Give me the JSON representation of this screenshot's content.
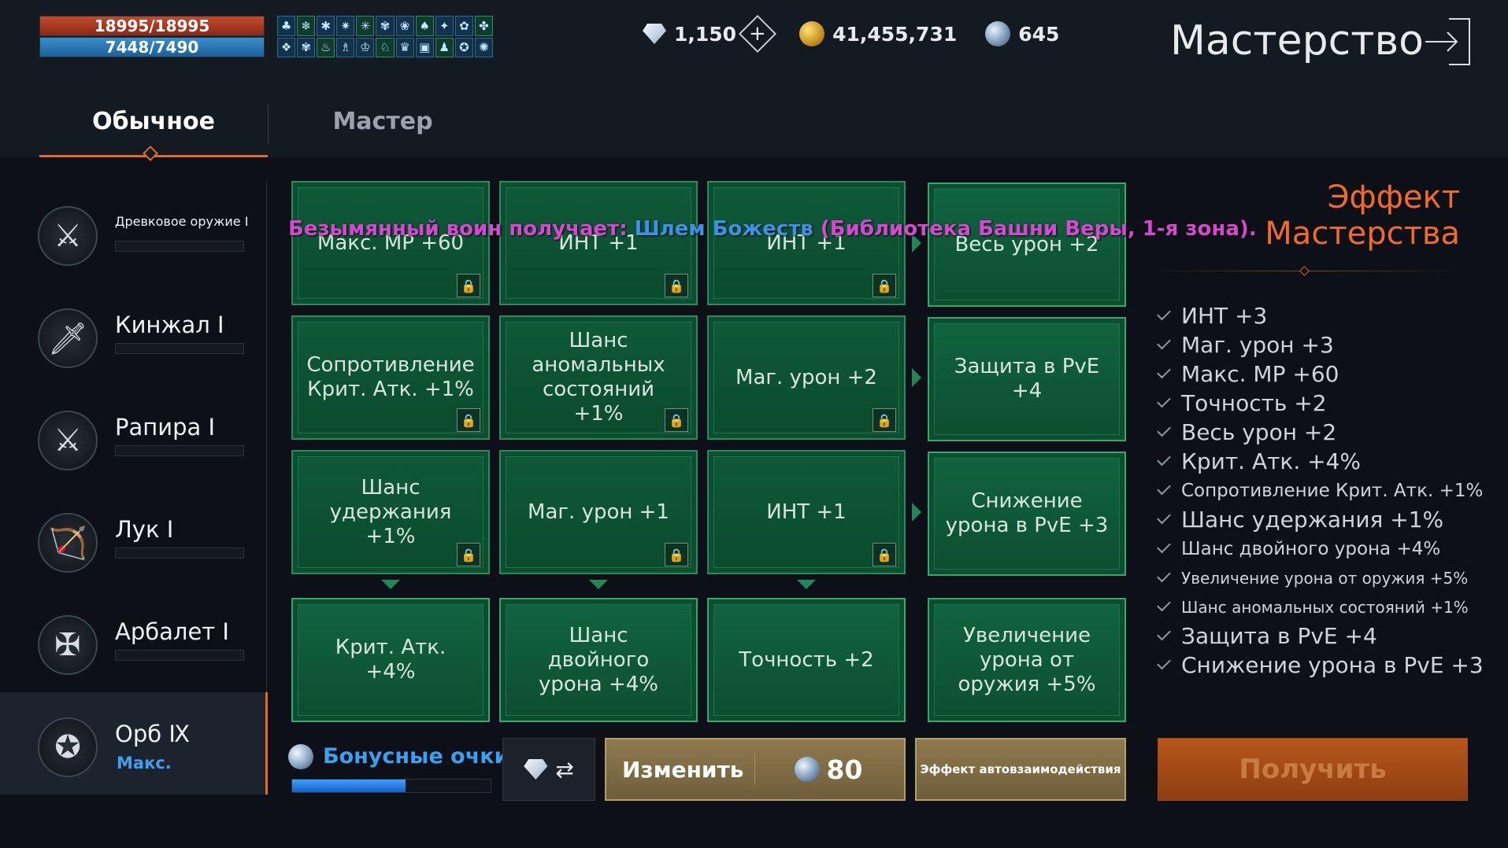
{
  "hud": {
    "hp": "18995/18995",
    "mp": "7448/7490",
    "buff_icons": [
      "♣",
      "❄",
      "✱",
      "✷",
      "✳",
      "✾",
      "❀",
      "♠",
      "✦",
      "✿",
      "✤",
      "❖",
      "✾",
      "♨",
      "♗",
      "♔",
      "♘",
      "♛",
      "▣",
      "♟",
      "✪",
      "✺"
    ]
  },
  "currencies": {
    "diamonds": "1,150",
    "gold": "41,455,731",
    "orbs": "645"
  },
  "screen_title": "Мастерство",
  "tabs": {
    "normal": "Обычное",
    "master": "Мастер"
  },
  "weapons": [
    {
      "name": "Древковое оружие  Ⅰ",
      "icon": "⚔",
      "active": false
    },
    {
      "name": "Кинжал  Ⅰ",
      "icon": "🗡",
      "active": false
    },
    {
      "name": "Рапира  Ⅰ",
      "icon": "⚔",
      "active": false
    },
    {
      "name": "Лук  Ⅰ",
      "icon": "🏹",
      "active": false
    },
    {
      "name": "Арбалет  Ⅰ",
      "icon": "✠",
      "active": false
    },
    {
      "name": "Орб Ⅸ",
      "sub": "Макс.",
      "icon": "✪",
      "active": true
    }
  ],
  "grid": {
    "row1": [
      "Макс. МР +60",
      "ИНТ +1",
      "ИНТ +1",
      "Весь урон +2"
    ],
    "row2": [
      "Сопротивление Крит. Атк. +1%",
      "Шанс аномальных состояний +1%",
      "Маг. урон +2",
      "Защита в PvE +4"
    ],
    "row3": [
      "Шанс удержания +1%",
      "Маг. урон +1",
      "ИНТ +1",
      "Снижение урона в PvE +3"
    ],
    "row4": [
      "Крит. Атк. +4%",
      "Шанс двойного урона +4%",
      "Точность +2",
      "Увеличение урона от оружия +5%"
    ]
  },
  "notice": {
    "prefix": "Безымянный воин получает: ",
    "item": "Шлем Божеств",
    "suffix": " (Библиотека Башни Веры, 1-я зона)."
  },
  "effects": {
    "title": "Эффект Мастерства",
    "list": [
      "ИНТ +3",
      "Маг. урон +3",
      "Макс. МР +60",
      "Точность +2",
      "Весь урон +2",
      "Крит. Атк. +4%",
      "Сопротивление Крит. Атк. +1%",
      "Шанс удержания +1%",
      "Шанс двойного урона +4%",
      "Увеличение урона от оружия +5%",
      "Шанс аномальных состояний +1%",
      "Защита в PvE +4",
      "Снижение урона в PvE +3"
    ]
  },
  "bottom": {
    "bonus_label": "Бонусные очки",
    "bonus_progress": 0.57,
    "change_label": "Изменить",
    "change_cost": "80",
    "auto_label": "Эффект автовзаимодействия",
    "get_label": "Получить"
  },
  "colors": {
    "accent": "#e06a2a",
    "node_green": "#0e5a38",
    "notice_magenta": "#d648cf",
    "item_blue": "#3f8fe6"
  }
}
